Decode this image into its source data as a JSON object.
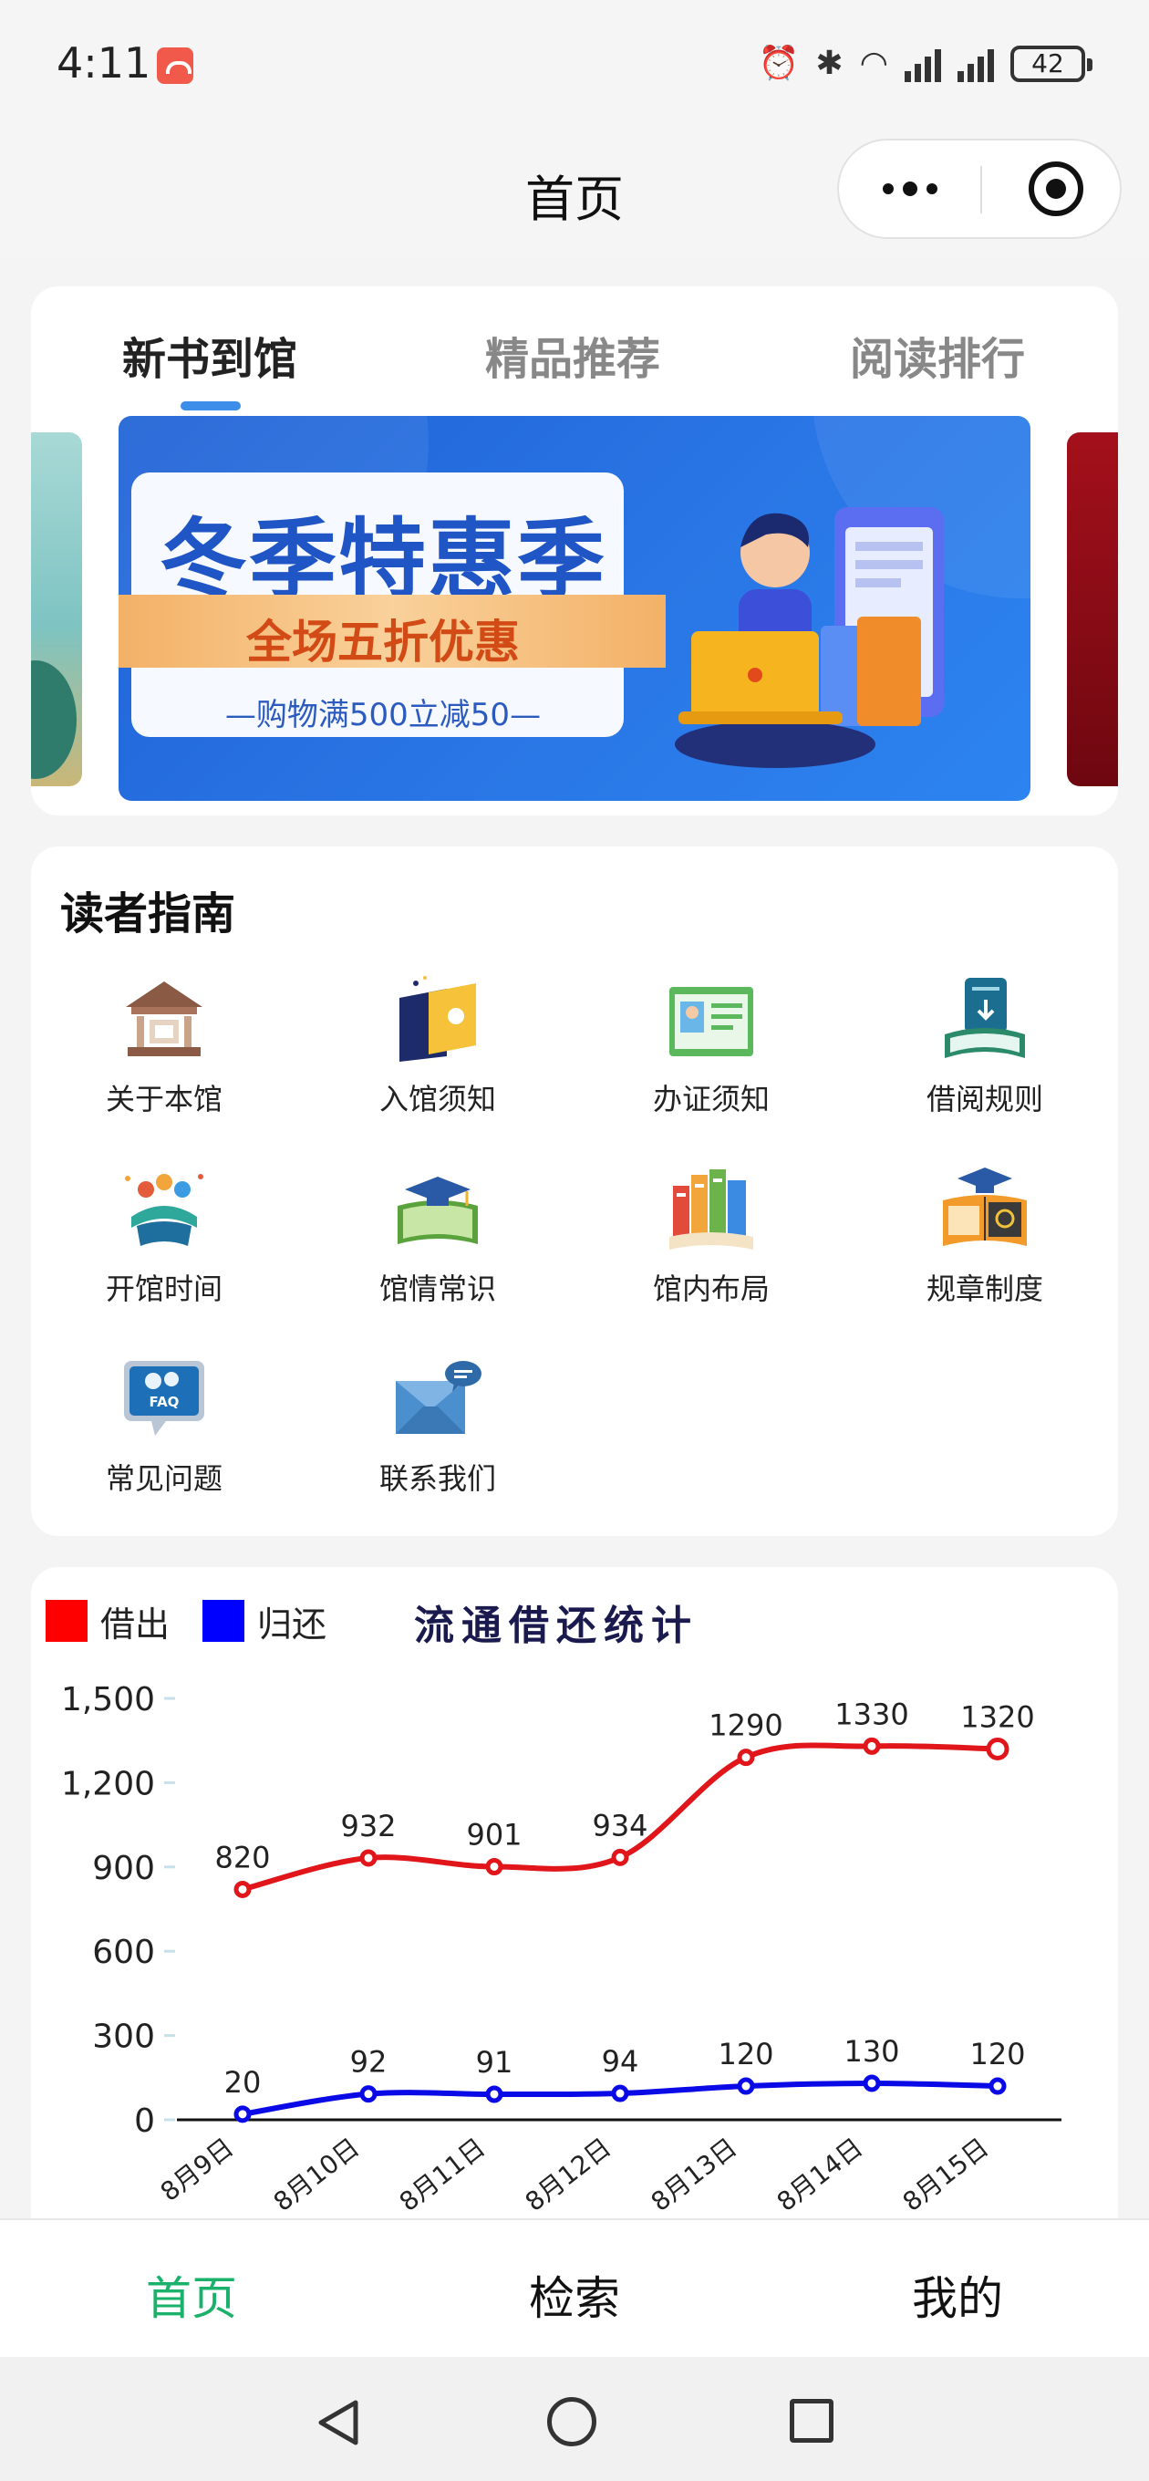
{
  "status_bar": {
    "time": "4:11",
    "battery": "42",
    "icons": [
      "app-notification-icon",
      "alarm-icon",
      "bluetooth-icon",
      "wifi-icon",
      "signal-icon",
      "signal-icon",
      "battery-icon"
    ]
  },
  "nav": {
    "title": "首页",
    "more_icon": "more-dots-icon",
    "target_icon": "target-icon"
  },
  "tabs": [
    {
      "label": "新书到馆",
      "active": true
    },
    {
      "label": "精品推荐",
      "active": false
    },
    {
      "label": "阅读排行",
      "active": false
    }
  ],
  "banner": {
    "title": "冬季特惠季",
    "subtitle": "全场五折优惠",
    "note": "—购物满500立减50—"
  },
  "guide": {
    "title": "读者指南",
    "items": [
      {
        "label": "关于本馆",
        "icon": "library-building-icon"
      },
      {
        "label": "入馆须知",
        "icon": "notice-book-icon"
      },
      {
        "label": "办证须知",
        "icon": "id-card-icon"
      },
      {
        "label": "借阅规则",
        "icon": "borrow-book-icon"
      },
      {
        "label": "开馆时间",
        "icon": "reading-people-icon"
      },
      {
        "label": "馆情常识",
        "icon": "graduation-book-icon"
      },
      {
        "label": "馆内布局",
        "icon": "books-layout-icon"
      },
      {
        "label": "规章制度",
        "icon": "rules-book-icon"
      },
      {
        "label": "常见问题",
        "icon": "faq-icon"
      },
      {
        "label": "联系我们",
        "icon": "mail-icon"
      }
    ]
  },
  "chart_data": {
    "type": "line",
    "title": "流通借还统计",
    "categories": [
      "8月9日",
      "8月10日",
      "8月11日",
      "8月12日",
      "8月13日",
      "8月14日",
      "8月15日"
    ],
    "series": [
      {
        "name": "借出",
        "color": "#e0161b",
        "values": [
          820,
          932,
          901,
          934,
          1290,
          1330,
          1320
        ]
      },
      {
        "name": "归还",
        "color": "#0a0ae6",
        "values": [
          20,
          92,
          91,
          94,
          120,
          130,
          120
        ]
      }
    ],
    "yticks": [
      "1,500",
      "1,200",
      "900",
      "600",
      "300",
      "0"
    ],
    "ylim": [
      0,
      1500
    ],
    "legend_position": "top-left",
    "grid": false
  },
  "tabbar": {
    "items": [
      {
        "label": "首页",
        "active": true
      },
      {
        "label": "检索",
        "active": false
      },
      {
        "label": "我的",
        "active": false
      }
    ]
  },
  "system_nav": {
    "icons": [
      "back-icon",
      "home-icon",
      "recent-apps-icon"
    ]
  }
}
